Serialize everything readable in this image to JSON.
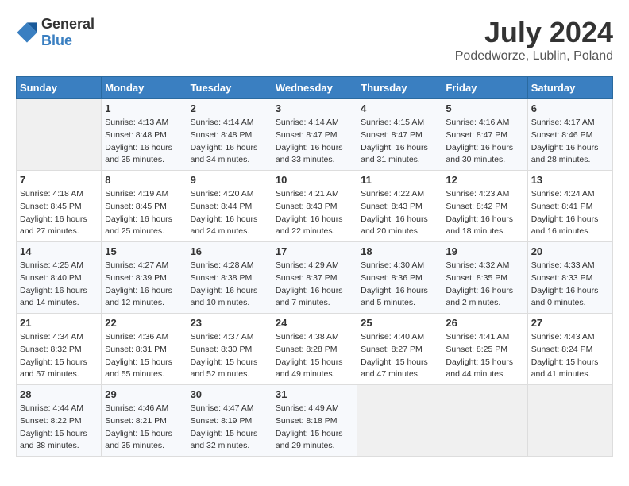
{
  "header": {
    "logo": {
      "general": "General",
      "blue": "Blue"
    },
    "title": "July 2024",
    "location": "Podedworze, Lublin, Poland"
  },
  "calendar": {
    "days_of_week": [
      "Sunday",
      "Monday",
      "Tuesday",
      "Wednesday",
      "Thursday",
      "Friday",
      "Saturday"
    ],
    "weeks": [
      [
        {
          "day": "",
          "info": ""
        },
        {
          "day": "1",
          "info": "Sunrise: 4:13 AM\nSunset: 8:48 PM\nDaylight: 16 hours\nand 35 minutes."
        },
        {
          "day": "2",
          "info": "Sunrise: 4:14 AM\nSunset: 8:48 PM\nDaylight: 16 hours\nand 34 minutes."
        },
        {
          "day": "3",
          "info": "Sunrise: 4:14 AM\nSunset: 8:47 PM\nDaylight: 16 hours\nand 33 minutes."
        },
        {
          "day": "4",
          "info": "Sunrise: 4:15 AM\nSunset: 8:47 PM\nDaylight: 16 hours\nand 31 minutes."
        },
        {
          "day": "5",
          "info": "Sunrise: 4:16 AM\nSunset: 8:47 PM\nDaylight: 16 hours\nand 30 minutes."
        },
        {
          "day": "6",
          "info": "Sunrise: 4:17 AM\nSunset: 8:46 PM\nDaylight: 16 hours\nand 28 minutes."
        }
      ],
      [
        {
          "day": "7",
          "info": "Sunrise: 4:18 AM\nSunset: 8:45 PM\nDaylight: 16 hours\nand 27 minutes."
        },
        {
          "day": "8",
          "info": "Sunrise: 4:19 AM\nSunset: 8:45 PM\nDaylight: 16 hours\nand 25 minutes."
        },
        {
          "day": "9",
          "info": "Sunrise: 4:20 AM\nSunset: 8:44 PM\nDaylight: 16 hours\nand 24 minutes."
        },
        {
          "day": "10",
          "info": "Sunrise: 4:21 AM\nSunset: 8:43 PM\nDaylight: 16 hours\nand 22 minutes."
        },
        {
          "day": "11",
          "info": "Sunrise: 4:22 AM\nSunset: 8:43 PM\nDaylight: 16 hours\nand 20 minutes."
        },
        {
          "day": "12",
          "info": "Sunrise: 4:23 AM\nSunset: 8:42 PM\nDaylight: 16 hours\nand 18 minutes."
        },
        {
          "day": "13",
          "info": "Sunrise: 4:24 AM\nSunset: 8:41 PM\nDaylight: 16 hours\nand 16 minutes."
        }
      ],
      [
        {
          "day": "14",
          "info": "Sunrise: 4:25 AM\nSunset: 8:40 PM\nDaylight: 16 hours\nand 14 minutes."
        },
        {
          "day": "15",
          "info": "Sunrise: 4:27 AM\nSunset: 8:39 PM\nDaylight: 16 hours\nand 12 minutes."
        },
        {
          "day": "16",
          "info": "Sunrise: 4:28 AM\nSunset: 8:38 PM\nDaylight: 16 hours\nand 10 minutes."
        },
        {
          "day": "17",
          "info": "Sunrise: 4:29 AM\nSunset: 8:37 PM\nDaylight: 16 hours\nand 7 minutes."
        },
        {
          "day": "18",
          "info": "Sunrise: 4:30 AM\nSunset: 8:36 PM\nDaylight: 16 hours\nand 5 minutes."
        },
        {
          "day": "19",
          "info": "Sunrise: 4:32 AM\nSunset: 8:35 PM\nDaylight: 16 hours\nand 2 minutes."
        },
        {
          "day": "20",
          "info": "Sunrise: 4:33 AM\nSunset: 8:33 PM\nDaylight: 16 hours\nand 0 minutes."
        }
      ],
      [
        {
          "day": "21",
          "info": "Sunrise: 4:34 AM\nSunset: 8:32 PM\nDaylight: 15 hours\nand 57 minutes."
        },
        {
          "day": "22",
          "info": "Sunrise: 4:36 AM\nSunset: 8:31 PM\nDaylight: 15 hours\nand 55 minutes."
        },
        {
          "day": "23",
          "info": "Sunrise: 4:37 AM\nSunset: 8:30 PM\nDaylight: 15 hours\nand 52 minutes."
        },
        {
          "day": "24",
          "info": "Sunrise: 4:38 AM\nSunset: 8:28 PM\nDaylight: 15 hours\nand 49 minutes."
        },
        {
          "day": "25",
          "info": "Sunrise: 4:40 AM\nSunset: 8:27 PM\nDaylight: 15 hours\nand 47 minutes."
        },
        {
          "day": "26",
          "info": "Sunrise: 4:41 AM\nSunset: 8:25 PM\nDaylight: 15 hours\nand 44 minutes."
        },
        {
          "day": "27",
          "info": "Sunrise: 4:43 AM\nSunset: 8:24 PM\nDaylight: 15 hours\nand 41 minutes."
        }
      ],
      [
        {
          "day": "28",
          "info": "Sunrise: 4:44 AM\nSunset: 8:22 PM\nDaylight: 15 hours\nand 38 minutes."
        },
        {
          "day": "29",
          "info": "Sunrise: 4:46 AM\nSunset: 8:21 PM\nDaylight: 15 hours\nand 35 minutes."
        },
        {
          "day": "30",
          "info": "Sunrise: 4:47 AM\nSunset: 8:19 PM\nDaylight: 15 hours\nand 32 minutes."
        },
        {
          "day": "31",
          "info": "Sunrise: 4:49 AM\nSunset: 8:18 PM\nDaylight: 15 hours\nand 29 minutes."
        },
        {
          "day": "",
          "info": ""
        },
        {
          "day": "",
          "info": ""
        },
        {
          "day": "",
          "info": ""
        }
      ]
    ]
  }
}
